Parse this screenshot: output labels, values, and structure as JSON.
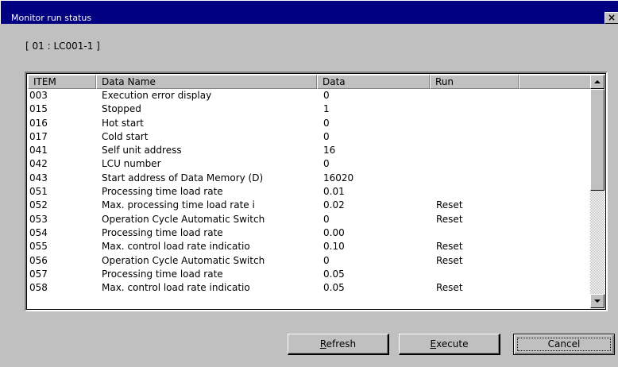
{
  "window": {
    "title": "Monitor run status",
    "close_glyph": "×"
  },
  "unit_label": "[ 01 : LC001-1 ]",
  "table": {
    "columns": [
      "ITEM",
      "Data Name",
      "Data",
      "Run",
      ""
    ],
    "rows": [
      {
        "item": "003",
        "name": "Execution error display",
        "data": "0",
        "run": ""
      },
      {
        "item": "015",
        "name": "Stopped",
        "data": "1",
        "run": ""
      },
      {
        "item": "016",
        "name": "Hot start",
        "data": "0",
        "run": ""
      },
      {
        "item": "017",
        "name": "Cold start",
        "data": "0",
        "run": ""
      },
      {
        "item": "041",
        "name": "Self unit address",
        "data": "16",
        "run": ""
      },
      {
        "item": "042",
        "name": "LCU number",
        "data": "0",
        "run": ""
      },
      {
        "item": "043",
        "name": "Start address of Data Memory (D)",
        "data": "16020",
        "run": ""
      },
      {
        "item": "051",
        "name": "Processing time load rate",
        "data": "0.01",
        "run": ""
      },
      {
        "item": "052",
        "name": "Max. processing time load rate i",
        "data": "0.02",
        "run": "Reset"
      },
      {
        "item": "053",
        "name": "Operation Cycle Automatic Switch",
        "data": "0",
        "run": "Reset"
      },
      {
        "item": "054",
        "name": "Processing time load rate",
        "data": "0.00",
        "run": ""
      },
      {
        "item": "055",
        "name": "Max. control load rate indicatio",
        "data": "0.10",
        "run": "Reset"
      },
      {
        "item": "056",
        "name": "Operation Cycle Automatic Switch",
        "data": "0",
        "run": "Reset"
      },
      {
        "item": "057",
        "name": "Processing time load rate",
        "data": "0.05",
        "run": ""
      },
      {
        "item": "058",
        "name": "Max. control load rate indicatio",
        "data": "0.05",
        "run": "Reset"
      }
    ],
    "scroll": {
      "up_icon": "arrow-up-icon",
      "down_icon": "arrow-down-icon"
    }
  },
  "buttons": {
    "refresh": {
      "accel": "R",
      "rest": "efresh"
    },
    "execute": {
      "accel": "E",
      "rest": "xecute"
    },
    "cancel": "Cancel"
  }
}
